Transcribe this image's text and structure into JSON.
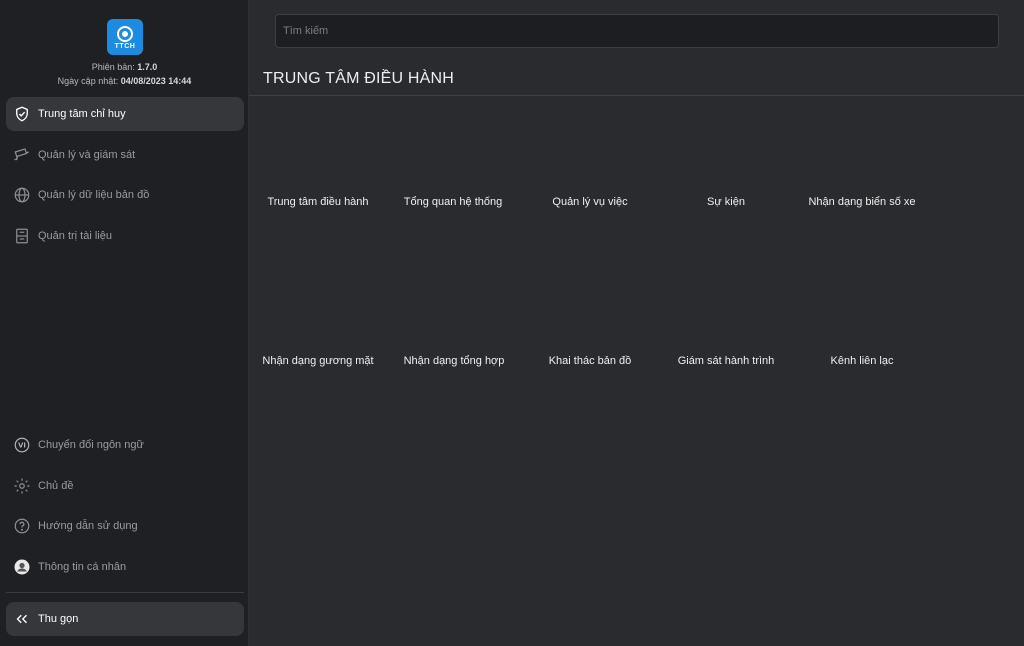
{
  "app": {
    "logo_text": "TTCH",
    "version_label": "Phiên bản:",
    "version": "1.7.0",
    "updated_label": "Ngày cập nhật:",
    "updated": "04/08/2023 14:44"
  },
  "sidebar": {
    "items": [
      {
        "label": "Trung tâm chỉ huy",
        "icon": "shield-check-icon",
        "active": true
      },
      {
        "label": "Quản lý và giám sát",
        "icon": "cctv-camera-icon"
      },
      {
        "label": "Quản lý dữ liệu bản đồ",
        "icon": "globe-icon"
      },
      {
        "label": "Quản trị tài liệu",
        "icon": "archive-icon"
      }
    ],
    "bottom_items": [
      {
        "label": "Chuyển đổi ngôn ngữ",
        "icon": "language-vi-icon",
        "badge": "VI"
      },
      {
        "label": "Chủ đề",
        "icon": "gear-icon"
      },
      {
        "label": "Hướng dẫn sử dụng",
        "icon": "help-circle-icon"
      },
      {
        "label": "Thông tin cá nhân",
        "icon": "avatar-icon"
      }
    ],
    "collapse_label": "Thu gọn"
  },
  "search": {
    "placeholder": "Tìm kiếm",
    "value": ""
  },
  "main": {
    "title": "TRUNG TÂM ĐIỀU HÀNH",
    "tiles_row1": [
      "Trung tâm điều hành",
      "Tổng quan hệ thống",
      "Quản lý vụ việc",
      "Sự kiện",
      "Nhận dạng biển số xe"
    ],
    "tiles_row2": [
      "Nhận dạng gương mặt",
      "Nhận dạng tổng hợp",
      "Khai thác bản đồ",
      "Giám sát hành trình",
      "Kênh liên lạc"
    ]
  },
  "colors": {
    "sidebar_bg": "#1f2023",
    "main_bg": "#2a2b2e",
    "active_item_bg": "#36373b",
    "logo_blue": "#1c8be0"
  }
}
